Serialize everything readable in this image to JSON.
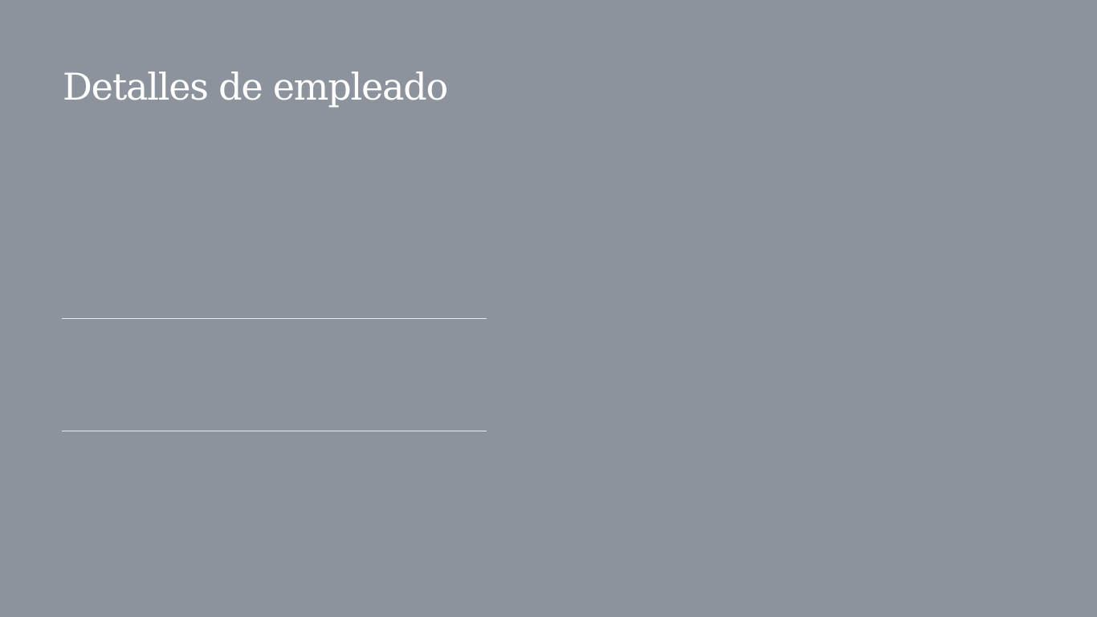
{
  "page": {
    "title": "Detalles de empleado",
    "background_color": "#8c939c",
    "text_color": "#ffffff",
    "line_color": "#e6e9ed"
  }
}
